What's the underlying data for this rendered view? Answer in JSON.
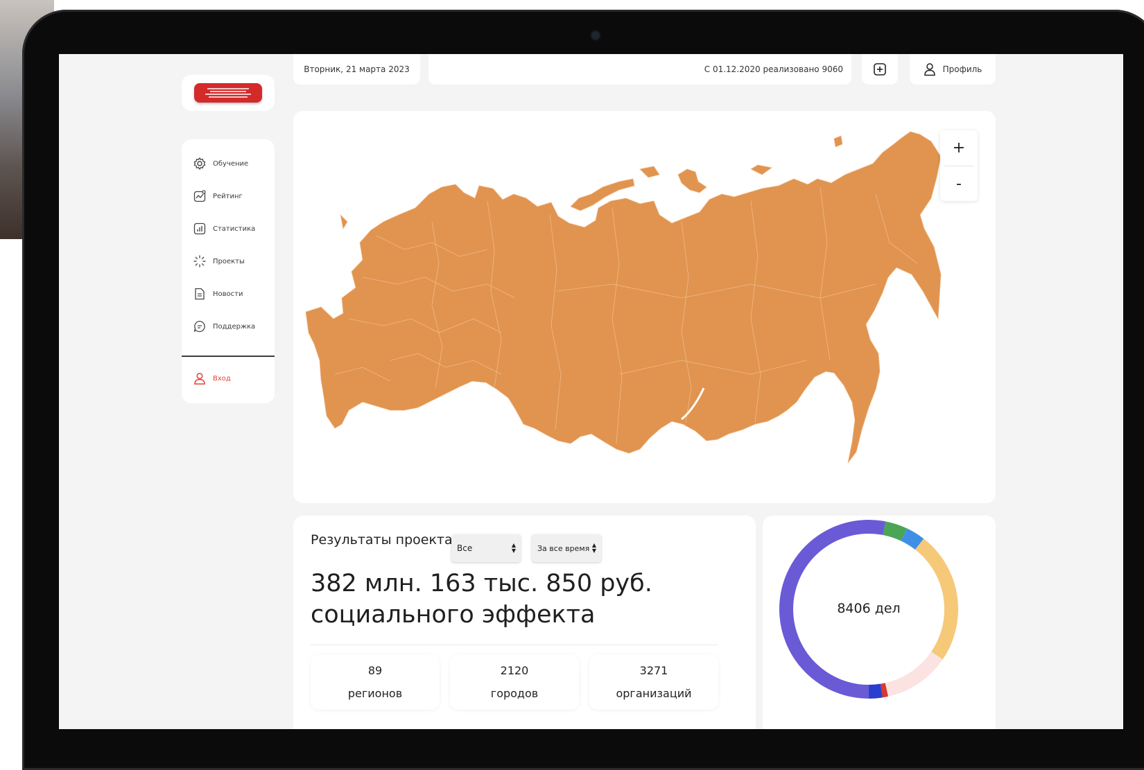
{
  "header": {
    "date": "Вторник, 21 марта 2023",
    "counter_text": "С 01.12.2020 реализовано 9060",
    "profile_label": "Профиль"
  },
  "logo": {
    "icon": "logo-icon"
  },
  "sidebar": {
    "items": [
      {
        "label": "Обучение",
        "icon": "gear-icon"
      },
      {
        "label": "Рейтинг",
        "icon": "chart-line-icon"
      },
      {
        "label": "Статистика",
        "icon": "bar-chart-icon"
      },
      {
        "label": "Проекты",
        "icon": "spinner-icon"
      },
      {
        "label": "Новости",
        "icon": "document-icon"
      },
      {
        "label": "Поддержка",
        "icon": "chat-icon"
      }
    ],
    "login": {
      "label": "Вход",
      "icon": "user-icon"
    }
  },
  "map": {
    "fill_color": "#e0944f",
    "zoom_in": "+",
    "zoom_out": "-"
  },
  "results": {
    "title": "Результаты проекта",
    "filter_region": "Все",
    "filter_period": "За все время",
    "value_line1": "382 млн. 163 тыс. 850 руб.",
    "value_line2": "социального эффекта",
    "stats": [
      {
        "value": "89",
        "label": "регионов"
      },
      {
        "value": "2120",
        "label": "городов"
      },
      {
        "value": "3271",
        "label": "организаций"
      }
    ]
  },
  "donut": {
    "center_label": "8406 дел",
    "segments": [
      {
        "color": "#6a5ad6",
        "fraction": 0.53
      },
      {
        "color": "#4aa557",
        "fraction": 0.04
      },
      {
        "color": "#3f8fe6",
        "fraction": 0.035
      },
      {
        "color": "#f6c978",
        "fraction": 0.24
      },
      {
        "color": "#fbe3e2",
        "fraction": 0.12
      },
      {
        "color": "#d63a2e",
        "fraction": 0.01
      },
      {
        "color": "#2a3fcf",
        "fraction": 0.025
      }
    ]
  }
}
